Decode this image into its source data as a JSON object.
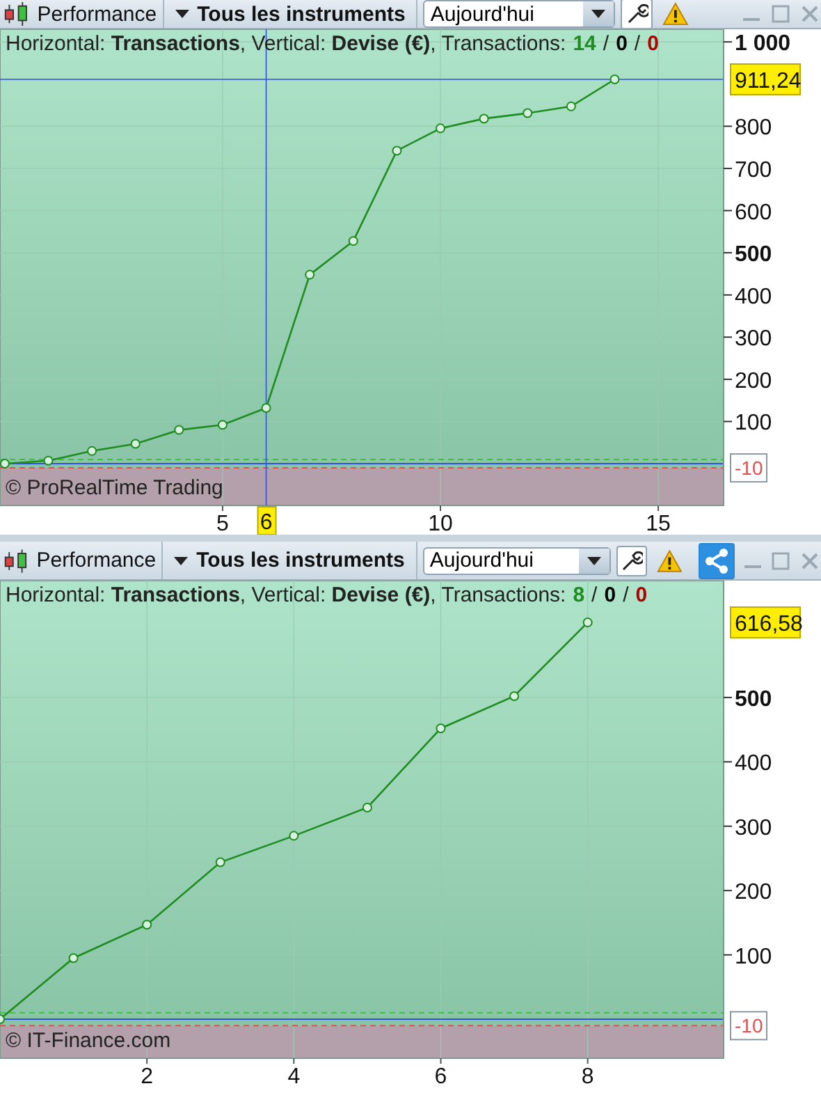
{
  "panels": [
    {
      "toolbar": {
        "title": "Performance",
        "instruments": "Tous les instruments",
        "period": "Aujourd'hui"
      },
      "info": {
        "text": "Horizontal: **Transactions**, Vertical: **Devise (€)**, Transactions:",
        "separator": "/",
        "counts": [
          {
            "value": "14",
            "color": "#1e8c1e"
          },
          {
            "value": "0",
            "color": "#000000"
          },
          {
            "value": "0",
            "color": "#b00000"
          }
        ]
      },
      "copyright": "© ProRealTime Trading",
      "chart_data": {
        "type": "line",
        "x": [
          0,
          1,
          2,
          3,
          4,
          5,
          6,
          7,
          8,
          9,
          10,
          11,
          12,
          13,
          14
        ],
        "series": [
          {
            "color": "#1e8c1e",
            "marker": "circle",
            "values": [
              0,
              7,
              30,
              47,
              80,
              92,
              132,
              448,
              528,
              742,
              795,
              818,
              831,
              847,
              911.24
            ]
          }
        ],
        "xlim": [
          -0.11,
          16.5
        ],
        "ylim": [
          -99,
          1030
        ],
        "xticks": [
          5,
          10,
          15
        ],
        "yticks": [
          1000,
          800,
          700,
          600,
          500,
          400,
          300,
          200,
          100,
          -10
        ],
        "grid": true,
        "bands": [
          {
            "axis": "y",
            "from": -99,
            "to": -10,
            "color": "#b4a0aa"
          }
        ],
        "ref_lines": [
          {
            "axis": "y",
            "value": 10,
            "color": "#40c040"
          },
          {
            "axis": "y",
            "value": 0,
            "color": "#3050e0"
          },
          {
            "axis": "y",
            "value": -10,
            "color": "#e05050"
          },
          {
            "axis": "x",
            "value": 6,
            "color": "#3050e0",
            "label": "6"
          },
          {
            "axis": "y",
            "value": 911.24,
            "color": "#3050e0",
            "label": "911,24"
          }
        ]
      }
    },
    {
      "toolbar": {
        "title": "Performance",
        "instruments": "Tous les instruments",
        "period": "Aujourd'hui",
        "share": true
      },
      "info": {
        "text": "Horizontal: **Transactions**, Vertical: **Devise (€)**, Transactions:",
        "separator": "/",
        "counts": [
          {
            "value": "8",
            "color": "#1e8c1e"
          },
          {
            "value": "0",
            "color": "#000000"
          },
          {
            "value": "0",
            "color": "#b00000"
          }
        ]
      },
      "copyright": "© IT-Finance.com",
      "chart_data": {
        "type": "line",
        "x": [
          0,
          1,
          2,
          3,
          4,
          5,
          6,
          7,
          8
        ],
        "series": [
          {
            "color": "#1e8c1e",
            "marker": "circle",
            "values": [
              0,
              95,
              147,
              244,
              285,
              329,
              452,
              502,
              616.58
            ]
          }
        ],
        "xlim": [
          0,
          9.85
        ],
        "ylim": [
          -60.5,
          681.6
        ],
        "xticks": [
          2,
          4,
          6,
          8
        ],
        "yticks": [
          500,
          400,
          300,
          200,
          100,
          -10
        ],
        "grid": true,
        "bands": [
          {
            "axis": "y",
            "from": -60.5,
            "to": -10,
            "color": "#b4a0aa"
          }
        ],
        "ref_lines": [
          {
            "axis": "y",
            "value": 10,
            "color": "#40c040"
          },
          {
            "axis": "y",
            "value": 0,
            "color": "#3050e0"
          },
          {
            "axis": "y",
            "value": -10,
            "color": "#e05050"
          }
        ],
        "annotations": [
          "616,58"
        ]
      }
    }
  ]
}
